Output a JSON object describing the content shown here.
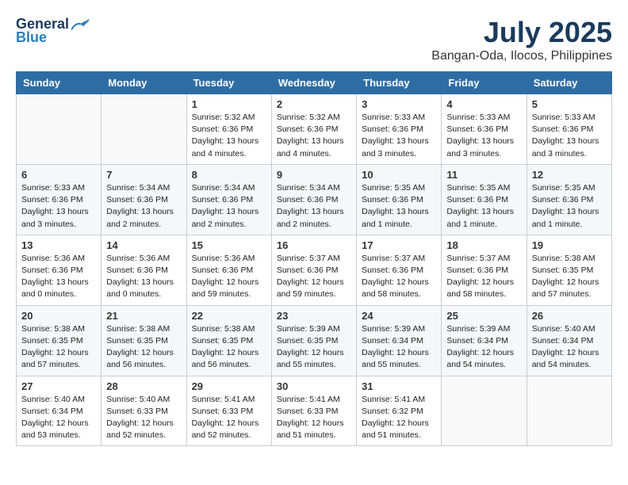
{
  "header": {
    "logo_general": "General",
    "logo_blue": "Blue",
    "month": "July 2025",
    "location": "Bangan-Oda, Ilocos, Philippines"
  },
  "weekdays": [
    "Sunday",
    "Monday",
    "Tuesday",
    "Wednesday",
    "Thursday",
    "Friday",
    "Saturday"
  ],
  "weeks": [
    [
      {
        "day": "",
        "sunrise": "",
        "sunset": "",
        "daylight": ""
      },
      {
        "day": "",
        "sunrise": "",
        "sunset": "",
        "daylight": ""
      },
      {
        "day": "1",
        "sunrise": "Sunrise: 5:32 AM",
        "sunset": "Sunset: 6:36 PM",
        "daylight": "Daylight: 13 hours and 4 minutes."
      },
      {
        "day": "2",
        "sunrise": "Sunrise: 5:32 AM",
        "sunset": "Sunset: 6:36 PM",
        "daylight": "Daylight: 13 hours and 4 minutes."
      },
      {
        "day": "3",
        "sunrise": "Sunrise: 5:33 AM",
        "sunset": "Sunset: 6:36 PM",
        "daylight": "Daylight: 13 hours and 3 minutes."
      },
      {
        "day": "4",
        "sunrise": "Sunrise: 5:33 AM",
        "sunset": "Sunset: 6:36 PM",
        "daylight": "Daylight: 13 hours and 3 minutes."
      },
      {
        "day": "5",
        "sunrise": "Sunrise: 5:33 AM",
        "sunset": "Sunset: 6:36 PM",
        "daylight": "Daylight: 13 hours and 3 minutes."
      }
    ],
    [
      {
        "day": "6",
        "sunrise": "Sunrise: 5:33 AM",
        "sunset": "Sunset: 6:36 PM",
        "daylight": "Daylight: 13 hours and 3 minutes."
      },
      {
        "day": "7",
        "sunrise": "Sunrise: 5:34 AM",
        "sunset": "Sunset: 6:36 PM",
        "daylight": "Daylight: 13 hours and 2 minutes."
      },
      {
        "day": "8",
        "sunrise": "Sunrise: 5:34 AM",
        "sunset": "Sunset: 6:36 PM",
        "daylight": "Daylight: 13 hours and 2 minutes."
      },
      {
        "day": "9",
        "sunrise": "Sunrise: 5:34 AM",
        "sunset": "Sunset: 6:36 PM",
        "daylight": "Daylight: 13 hours and 2 minutes."
      },
      {
        "day": "10",
        "sunrise": "Sunrise: 5:35 AM",
        "sunset": "Sunset: 6:36 PM",
        "daylight": "Daylight: 13 hours and 1 minute."
      },
      {
        "day": "11",
        "sunrise": "Sunrise: 5:35 AM",
        "sunset": "Sunset: 6:36 PM",
        "daylight": "Daylight: 13 hours and 1 minute."
      },
      {
        "day": "12",
        "sunrise": "Sunrise: 5:35 AM",
        "sunset": "Sunset: 6:36 PM",
        "daylight": "Daylight: 13 hours and 1 minute."
      }
    ],
    [
      {
        "day": "13",
        "sunrise": "Sunrise: 5:36 AM",
        "sunset": "Sunset: 6:36 PM",
        "daylight": "Daylight: 13 hours and 0 minutes."
      },
      {
        "day": "14",
        "sunrise": "Sunrise: 5:36 AM",
        "sunset": "Sunset: 6:36 PM",
        "daylight": "Daylight: 13 hours and 0 minutes."
      },
      {
        "day": "15",
        "sunrise": "Sunrise: 5:36 AM",
        "sunset": "Sunset: 6:36 PM",
        "daylight": "Daylight: 12 hours and 59 minutes."
      },
      {
        "day": "16",
        "sunrise": "Sunrise: 5:37 AM",
        "sunset": "Sunset: 6:36 PM",
        "daylight": "Daylight: 12 hours and 59 minutes."
      },
      {
        "day": "17",
        "sunrise": "Sunrise: 5:37 AM",
        "sunset": "Sunset: 6:36 PM",
        "daylight": "Daylight: 12 hours and 58 minutes."
      },
      {
        "day": "18",
        "sunrise": "Sunrise: 5:37 AM",
        "sunset": "Sunset: 6:36 PM",
        "daylight": "Daylight: 12 hours and 58 minutes."
      },
      {
        "day": "19",
        "sunrise": "Sunrise: 5:38 AM",
        "sunset": "Sunset: 6:35 PM",
        "daylight": "Daylight: 12 hours and 57 minutes."
      }
    ],
    [
      {
        "day": "20",
        "sunrise": "Sunrise: 5:38 AM",
        "sunset": "Sunset: 6:35 PM",
        "daylight": "Daylight: 12 hours and 57 minutes."
      },
      {
        "day": "21",
        "sunrise": "Sunrise: 5:38 AM",
        "sunset": "Sunset: 6:35 PM",
        "daylight": "Daylight: 12 hours and 56 minutes."
      },
      {
        "day": "22",
        "sunrise": "Sunrise: 5:38 AM",
        "sunset": "Sunset: 6:35 PM",
        "daylight": "Daylight: 12 hours and 56 minutes."
      },
      {
        "day": "23",
        "sunrise": "Sunrise: 5:39 AM",
        "sunset": "Sunset: 6:35 PM",
        "daylight": "Daylight: 12 hours and 55 minutes."
      },
      {
        "day": "24",
        "sunrise": "Sunrise: 5:39 AM",
        "sunset": "Sunset: 6:34 PM",
        "daylight": "Daylight: 12 hours and 55 minutes."
      },
      {
        "day": "25",
        "sunrise": "Sunrise: 5:39 AM",
        "sunset": "Sunset: 6:34 PM",
        "daylight": "Daylight: 12 hours and 54 minutes."
      },
      {
        "day": "26",
        "sunrise": "Sunrise: 5:40 AM",
        "sunset": "Sunset: 6:34 PM",
        "daylight": "Daylight: 12 hours and 54 minutes."
      }
    ],
    [
      {
        "day": "27",
        "sunrise": "Sunrise: 5:40 AM",
        "sunset": "Sunset: 6:34 PM",
        "daylight": "Daylight: 12 hours and 53 minutes."
      },
      {
        "day": "28",
        "sunrise": "Sunrise: 5:40 AM",
        "sunset": "Sunset: 6:33 PM",
        "daylight": "Daylight: 12 hours and 52 minutes."
      },
      {
        "day": "29",
        "sunrise": "Sunrise: 5:41 AM",
        "sunset": "Sunset: 6:33 PM",
        "daylight": "Daylight: 12 hours and 52 minutes."
      },
      {
        "day": "30",
        "sunrise": "Sunrise: 5:41 AM",
        "sunset": "Sunset: 6:33 PM",
        "daylight": "Daylight: 12 hours and 51 minutes."
      },
      {
        "day": "31",
        "sunrise": "Sunrise: 5:41 AM",
        "sunset": "Sunset: 6:32 PM",
        "daylight": "Daylight: 12 hours and 51 minutes."
      },
      {
        "day": "",
        "sunrise": "",
        "sunset": "",
        "daylight": ""
      },
      {
        "day": "",
        "sunrise": "",
        "sunset": "",
        "daylight": ""
      }
    ]
  ]
}
